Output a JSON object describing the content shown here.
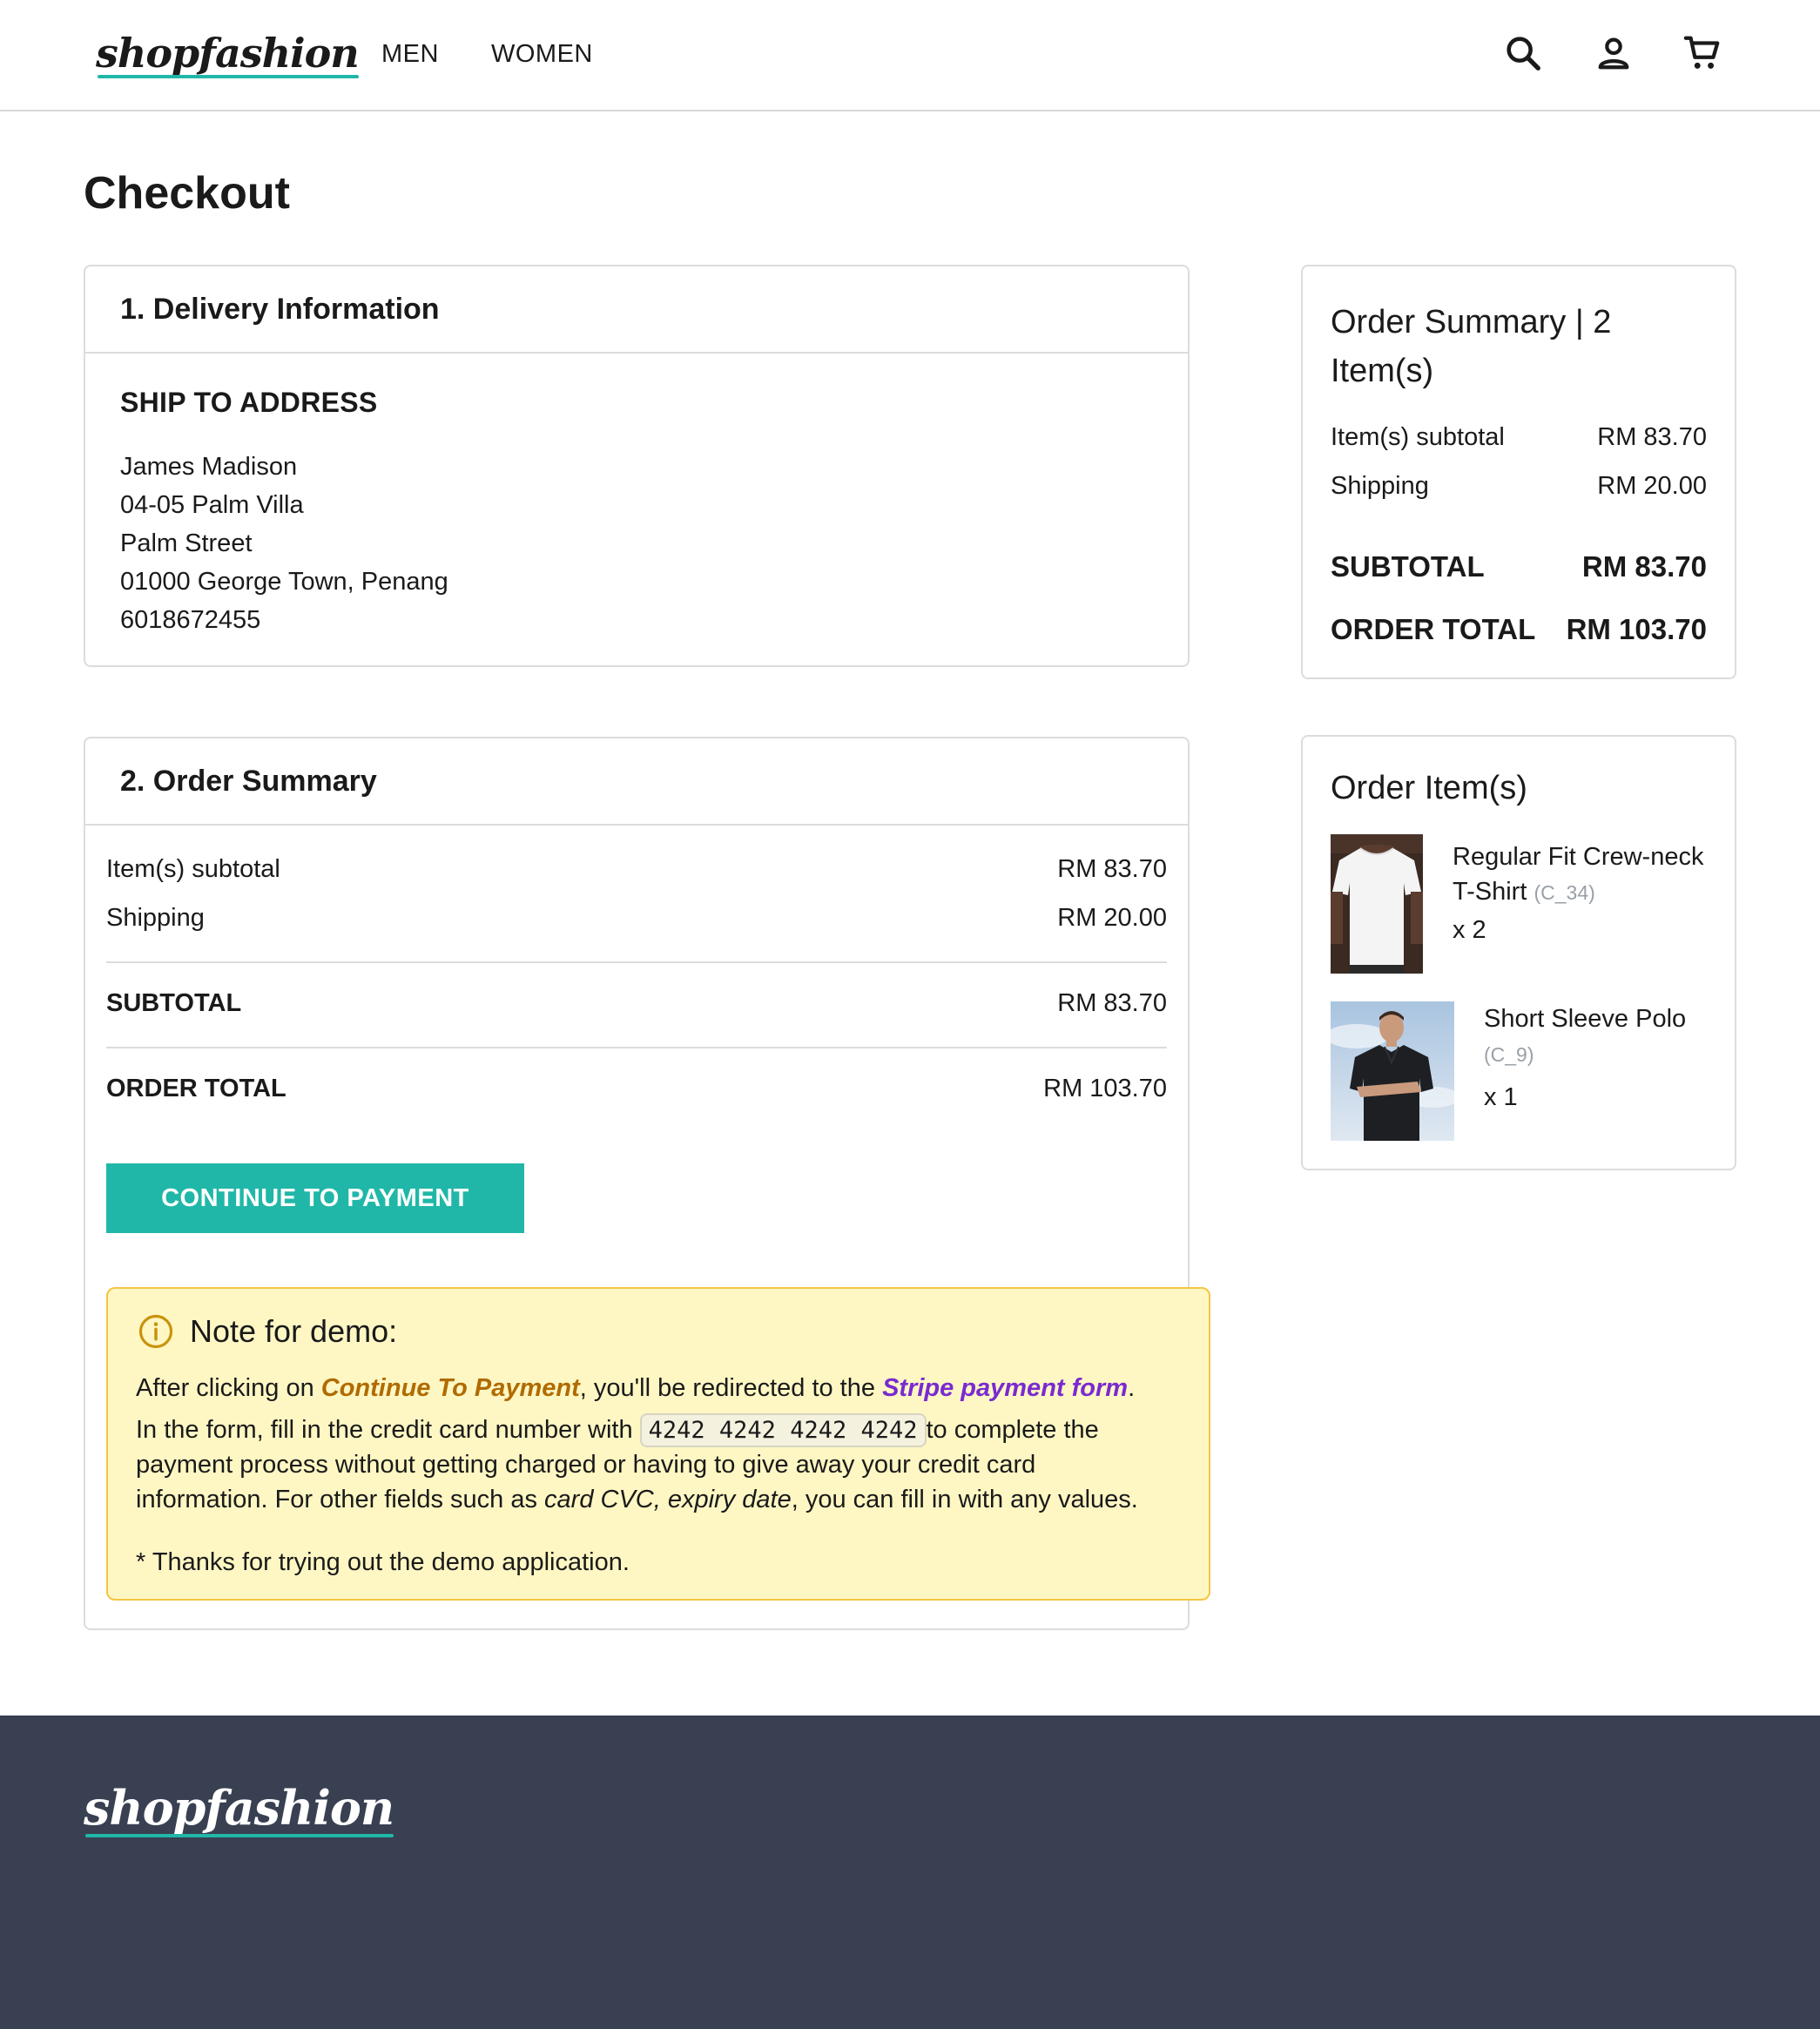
{
  "header": {
    "logo": "shopfashion",
    "nav": [
      "MEN",
      "WOMEN"
    ],
    "icons": [
      "search-icon",
      "account-icon",
      "cart-icon"
    ]
  },
  "page": {
    "title": "Checkout"
  },
  "delivery": {
    "title": "1. Delivery Information",
    "heading": "SHIP TO ADDRESS",
    "lines": [
      "James Madison",
      "04-05 Palm Villa",
      "Palm Street",
      "01000 George Town, Penang",
      "6018672455"
    ]
  },
  "order_summary": {
    "title": "2. Order Summary",
    "subtotal_label": "Item(s) subtotal",
    "subtotal_value": "RM 83.70",
    "shipping_label": "Shipping",
    "shipping_value": "RM 20.00",
    "sub_label": "SUBTOTAL",
    "sub_value": "RM 83.70",
    "total_label": "ORDER TOTAL",
    "total_value": "RM 103.70",
    "button": "CONTINUE TO PAYMENT"
  },
  "note": {
    "title": "Note for demo:",
    "p1_a": "After clicking on ",
    "p1_b": "Continue To Payment",
    "p1_c": ", you'll be redirected to the ",
    "p1_d": "Stripe payment form",
    "p1_e": ".",
    "p2_a": "In the form, fill in the credit card number with ",
    "card": "4242 4242 4242 4242",
    "p2_b": "to complete the",
    "p3": "payment process without getting charged or having to give away your credit card",
    "p4_a": "information. For other fields such as ",
    "p4_b": "card CVC, expiry date",
    "p4_c": ", you can fill in with any values.",
    "p5": "* Thanks for trying out the demo application."
  },
  "side_summary": {
    "title_line1": "Order Summary | 2",
    "title_line2": "Item(s)",
    "subtotal_label": "Item(s) subtotal",
    "subtotal_value": "RM 83.70",
    "shipping_label": "Shipping",
    "shipping_value": "RM 20.00",
    "sub_label": "SUBTOTAL",
    "sub_value": "RM 83.70",
    "total_label": "ORDER TOTAL",
    "total_value": "RM 103.70"
  },
  "order_items": {
    "title": "Order Item(s)",
    "items": [
      {
        "name_line1": "Regular Fit Crew-neck",
        "name_line2": "T-Shirt",
        "code": "(C_34)",
        "qty": "x 2"
      },
      {
        "name_line1": "Short Sleeve Polo",
        "code": "(C_9)",
        "qty": "x 1"
      }
    ]
  },
  "footer": {
    "logo": "shopfashion"
  },
  "colors": {
    "accent": "#20b7a8",
    "footer_bg": "#384052",
    "note_bg": "#fef7c3",
    "note_border": "#f5c542",
    "note_orange": "#b06b00",
    "note_purple": "#7a2ad1"
  }
}
